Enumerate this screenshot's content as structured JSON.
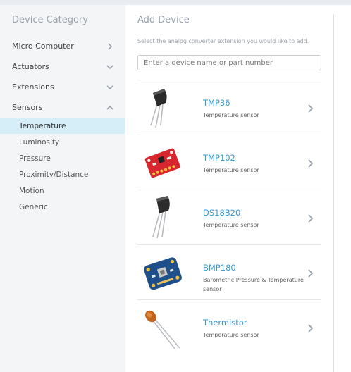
{
  "sidebar": {
    "title": "Device Category",
    "categories": [
      {
        "label": "Micro Computer",
        "chevron": "chevron-right"
      },
      {
        "label": "Actuators",
        "chevron": "chevron-down"
      },
      {
        "label": "Extensions",
        "chevron": "chevron-down"
      },
      {
        "label": "Sensors",
        "chevron": "chevron-up"
      }
    ],
    "subitems": [
      {
        "label": "Temperature",
        "active": true
      },
      {
        "label": "Luminosity",
        "active": false
      },
      {
        "label": "Pressure",
        "active": false
      },
      {
        "label": "Proximity/Distance",
        "active": false
      },
      {
        "label": "Motion",
        "active": false
      },
      {
        "label": "Generic",
        "active": false
      }
    ]
  },
  "main": {
    "title": "Add Device",
    "instruction": "Select the analog converter extension you would like to add.",
    "search": {
      "value": "",
      "placeholder": "Enter a device name or part number"
    },
    "devices": [
      {
        "name": "TMP36",
        "description": "Temperature sensor",
        "icon": "to92-sensor-icon"
      },
      {
        "name": "TMP102",
        "description": "Temperature sensor",
        "icon": "breakout-board-icon"
      },
      {
        "name": "DS18B20",
        "description": "Temperature sensor",
        "icon": "to92-sensor-icon"
      },
      {
        "name": "BMP180",
        "description": "Barometric Pressure & Temperature sensor",
        "icon": "bmp180-board-icon"
      },
      {
        "name": "Thermistor",
        "description": "Temperature sensor",
        "icon": "thermistor-icon"
      }
    ]
  },
  "colors": {
    "accent": "#3a9bd5",
    "active_bg": "#d6eef8",
    "sidebar_bg": "#f4f5f7",
    "muted_text": "#9aa3ad"
  }
}
